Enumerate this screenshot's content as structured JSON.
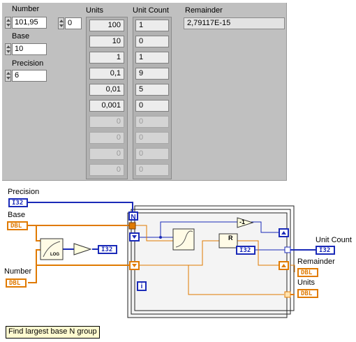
{
  "front_panel": {
    "number": {
      "label": "Number",
      "value": "101,95"
    },
    "base": {
      "label": "Base",
      "value": "10"
    },
    "precision": {
      "label": "Precision",
      "value": "6"
    },
    "array_index": {
      "value": "0"
    },
    "units": {
      "label": "Units",
      "values": [
        "100",
        "10",
        "1",
        "0,1",
        "0,01",
        "0,001",
        "0",
        "0",
        "0",
        "0"
      ]
    },
    "unit_count": {
      "label": "Unit Count",
      "values": [
        "1",
        "0",
        "1",
        "9",
        "5",
        "0",
        "0",
        "0",
        "0",
        "0"
      ]
    },
    "remainder": {
      "label": "Remainder",
      "value": "2,79117E-15"
    }
  },
  "block_diagram": {
    "labels": {
      "precision": "Precision",
      "base": "Base",
      "number": "Number",
      "unit_count": "Unit Count",
      "remainder": "Remainder",
      "units": "Units"
    },
    "terminals": {
      "precision": "I32",
      "base": "DBL",
      "number": "DBL",
      "unit_count": "I32",
      "remainder": "DBL",
      "units": "DBL",
      "to_i32": "I32",
      "quotient_i32": "I32"
    },
    "loop_count": "N",
    "loop_index": "i",
    "decrement": "-1",
    "log_glyph": "LOG",
    "divide_glyph": "R"
  },
  "comment": "Find largest base N group",
  "colors": {
    "int_wire": "#1a2ab8",
    "dbl_wire": "#e07a00",
    "panel": "#c0c0c0"
  }
}
